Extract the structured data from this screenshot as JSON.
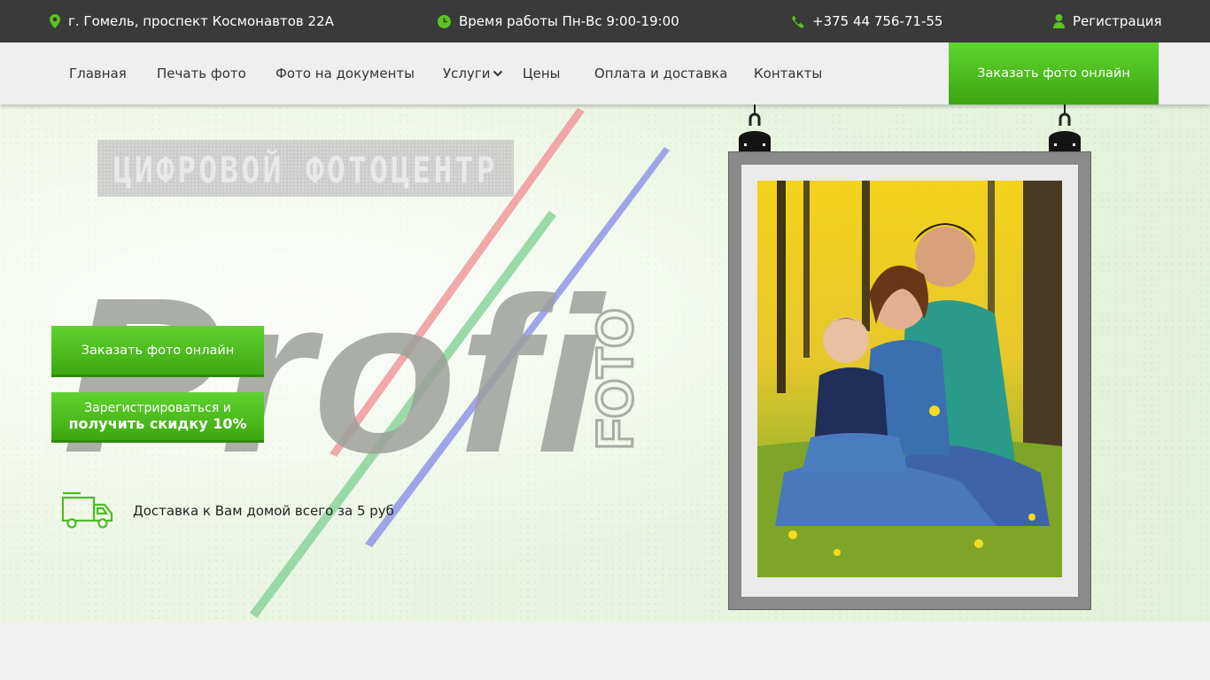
{
  "topbar": {
    "address": "г. Гомель, проспект Космонавтов 22А",
    "hours": "Время работы Пн-Вс 9:00-19:00",
    "phone": "+375 44 756-71-55",
    "register": "Регистрация",
    "icons": [
      "map-pin-icon",
      "clock-icon",
      "phone-icon",
      "user-icon"
    ],
    "accent": "#5ac31f"
  },
  "nav": {
    "items": [
      {
        "label": "Главная"
      },
      {
        "label": "Печать фото"
      },
      {
        "label": "Фото на документы"
      },
      {
        "label": "Услуги",
        "dropdown": true
      },
      {
        "label": "Цены"
      },
      {
        "label": "Оплата и доставка"
      },
      {
        "label": "Контакты"
      }
    ],
    "cta": "Заказать фото онлайн"
  },
  "hero": {
    "banner_text": "ЦИФРОВОЙ ФОТОЦЕНТР",
    "logo_main": "Profi",
    "logo_sub": "FOTO",
    "order_button": "Заказать фото онлайн",
    "register_button_line1": "Зарегистрироваться и",
    "register_button_line2": "получить скидку 10%",
    "delivery_text": "Доставка к Вам домой всего за 5 руб",
    "delivery_icon": "truck-icon"
  },
  "colors": {
    "green": "#4cbd20",
    "dark": "#3a3a3a",
    "nav_bg": "#efefef"
  }
}
